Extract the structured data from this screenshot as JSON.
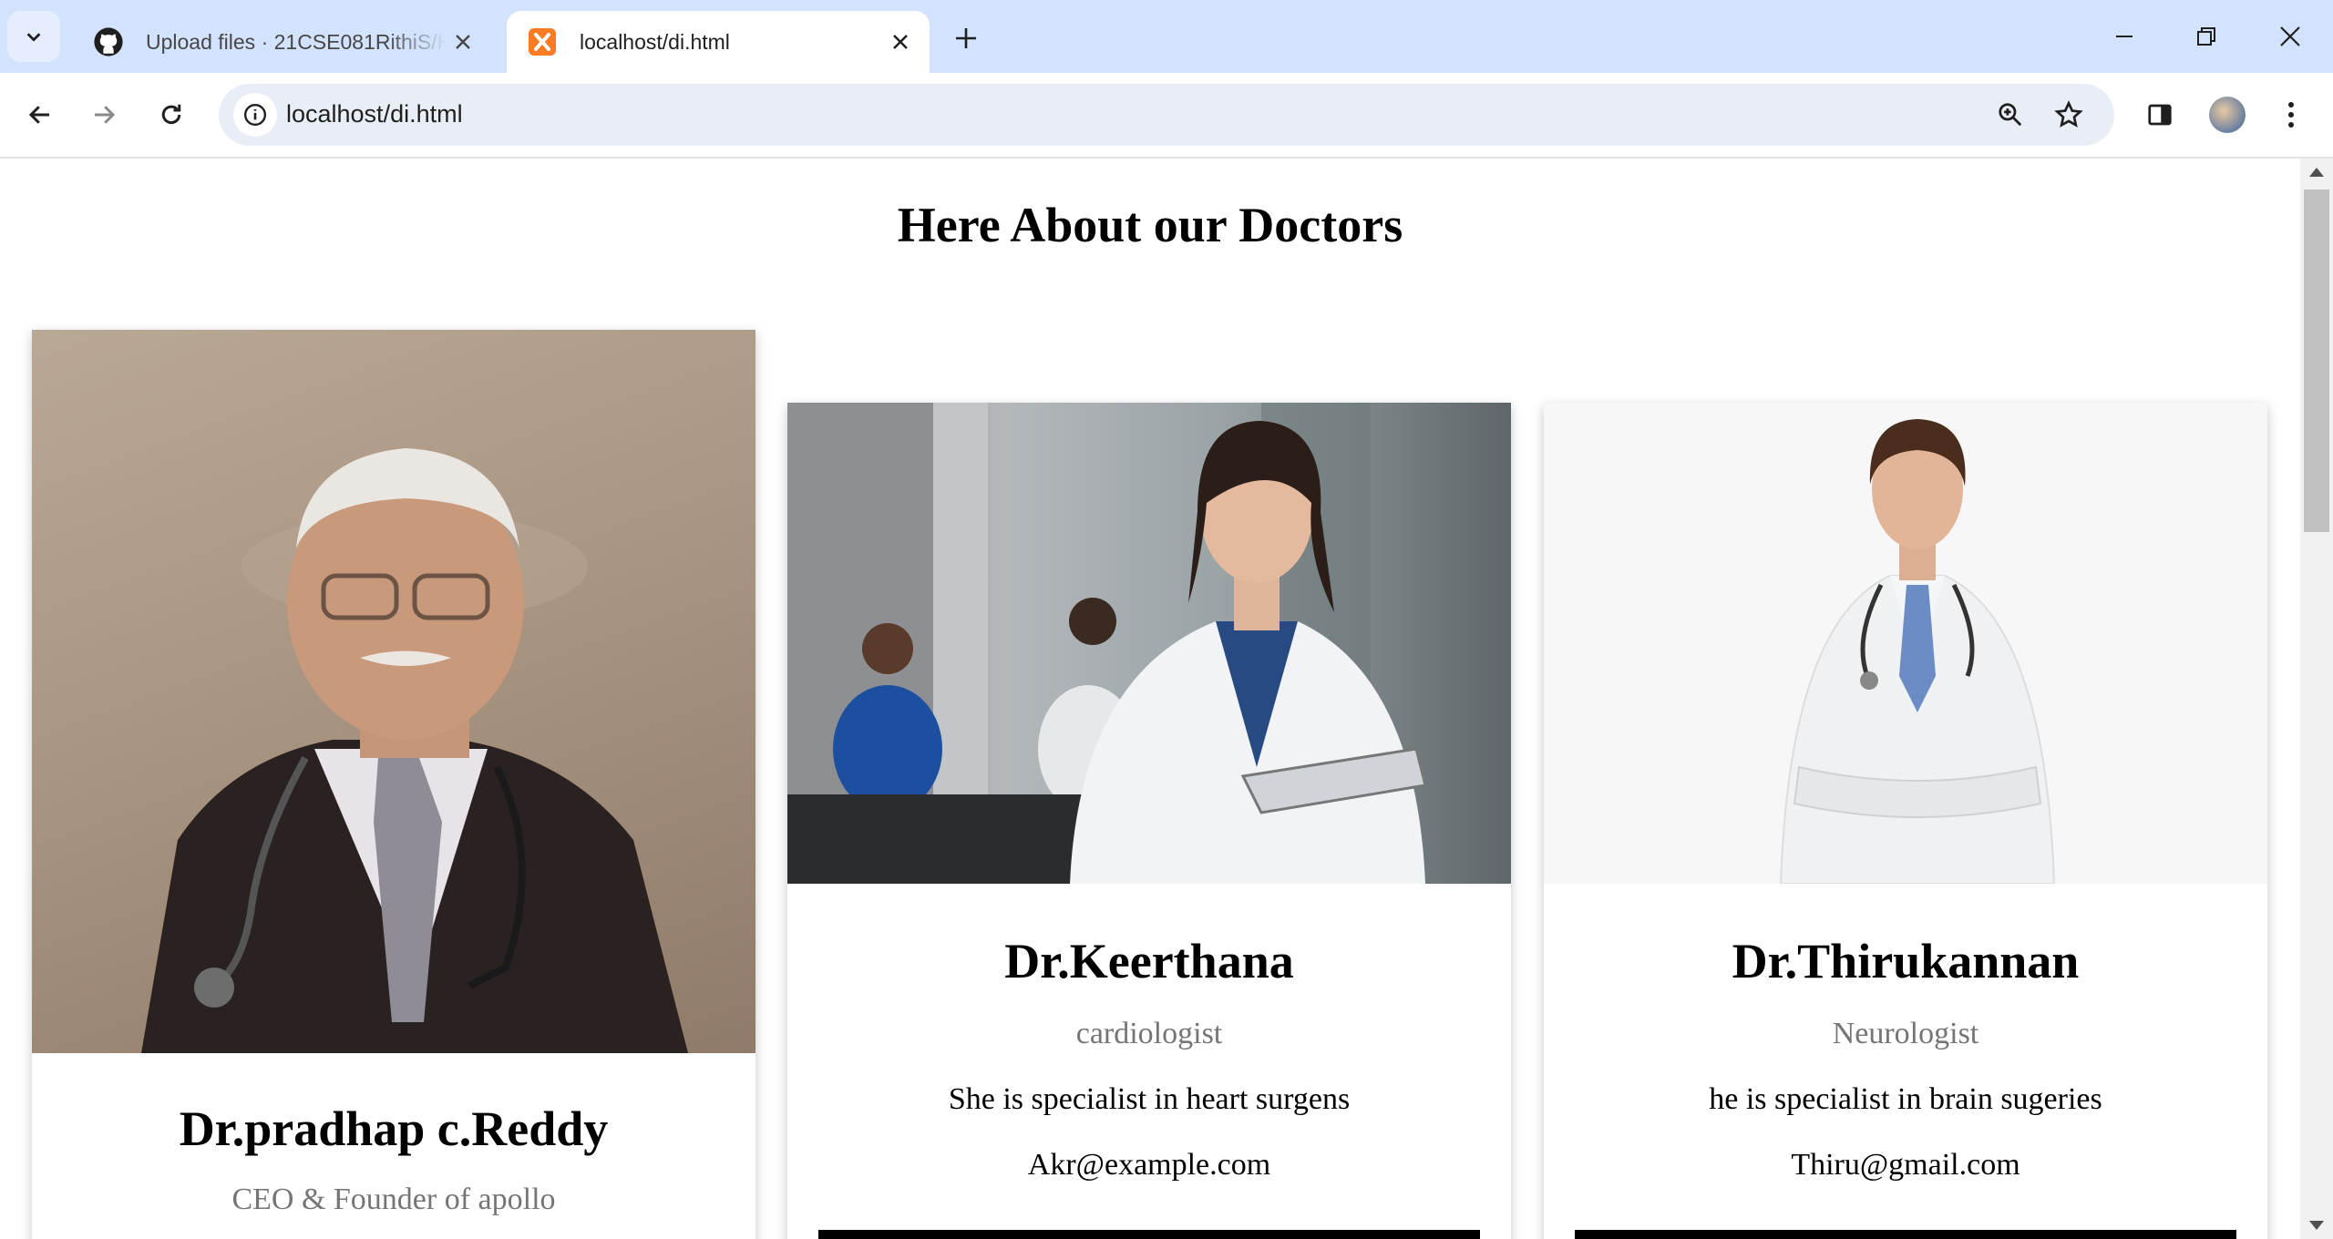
{
  "browser": {
    "tabs": [
      {
        "title": "Upload files · 21CSE081RithiS/H",
        "icon": "github-icon",
        "active": false
      },
      {
        "title": "localhost/di.html",
        "icon": "xampp-icon",
        "active": true
      }
    ],
    "url": "localhost/di.html"
  },
  "page": {
    "heading": "Here About our Doctors",
    "doctors": [
      {
        "name": "Dr.pradhap c.Reddy",
        "role": "CEO & Founder of apollo",
        "photo": "portrait-elderly-doctor-suit-stethoscope"
      },
      {
        "name": "Dr.Keerthana",
        "role": "cardiologist",
        "description": "She is specialist in heart surgens",
        "email": "Akr@example.com",
        "photo": "female-doctor-holding-tablet"
      },
      {
        "name": "Dr.Thirukannan",
        "role": "Neurologist",
        "description": "he is specialist in brain sugeries",
        "email": "Thiru@gmail.com",
        "photo": "male-doctor-arms-crossed"
      }
    ]
  },
  "colors": {
    "tabstrip": "#d3e3fd",
    "omnibox": "#e9eef6",
    "role_text": "#757575",
    "button": "#000000"
  }
}
